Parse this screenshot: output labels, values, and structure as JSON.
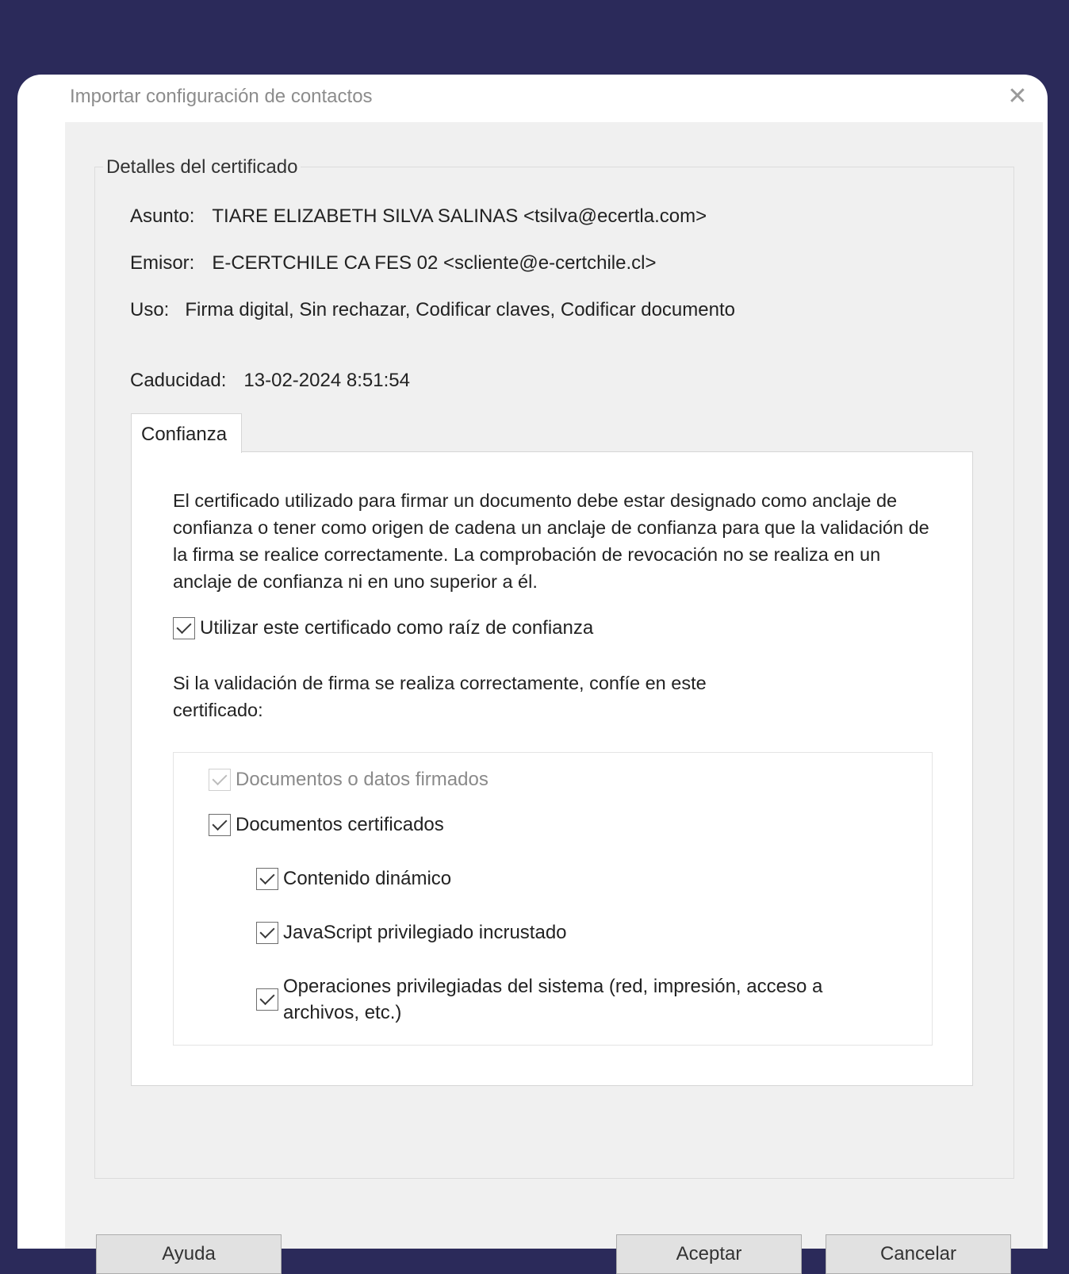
{
  "dialog": {
    "title": "Importar configuración de contactos",
    "close_glyph": "✕"
  },
  "details": {
    "legend": "Detalles del certificado",
    "asunto_label": "Asunto:",
    "asunto_value": "TIARE ELIZABETH SILVA SALINAS <tsilva@ecertla.com>",
    "emisor_label": "Emisor:",
    "emisor_value": "E-CERTCHILE CA FES 02 <scliente@e-certchile.cl>",
    "uso_label": "Uso:",
    "uso_value": "Firma digital, Sin rechazar, Codificar claves, Codificar documento",
    "caducidad_label": "Caducidad:",
    "caducidad_value": "13-02-2024 8:51:54"
  },
  "tabs": [
    {
      "label": "Confianza",
      "selected": true
    }
  ],
  "trust": {
    "description": "El certificado utilizado para firmar un documento debe estar designado como anclaje de confianza o tener como origen de cadena un anclaje de confianza para que la validación de la firma se realice correctamente. La comprobación de revocación no se realiza en un anclaje de confianza ni en uno superior a él.",
    "root_checkbox": {
      "label": "Utilizar este certificado como raíz de confianza",
      "checked": true
    },
    "intro": "Si la validación de firma se realiza correctamente, confíe en este certificado:",
    "options": [
      {
        "label": "Documentos o datos firmados",
        "checked": true,
        "disabled": true
      },
      {
        "label": "Documentos certificados",
        "checked": true,
        "disabled": false
      },
      {
        "label": "Contenido dinámico",
        "checked": true,
        "disabled": false
      },
      {
        "label": "JavaScript privilegiado incrustado",
        "checked": true,
        "disabled": false
      },
      {
        "label": "Operaciones privilegiadas del sistema (red, impresión, acceso a archivos, etc.)",
        "checked": true,
        "disabled": false
      }
    ]
  },
  "buttons": {
    "help": "Ayuda",
    "ok": "Aceptar",
    "cancel": "Cancelar"
  }
}
